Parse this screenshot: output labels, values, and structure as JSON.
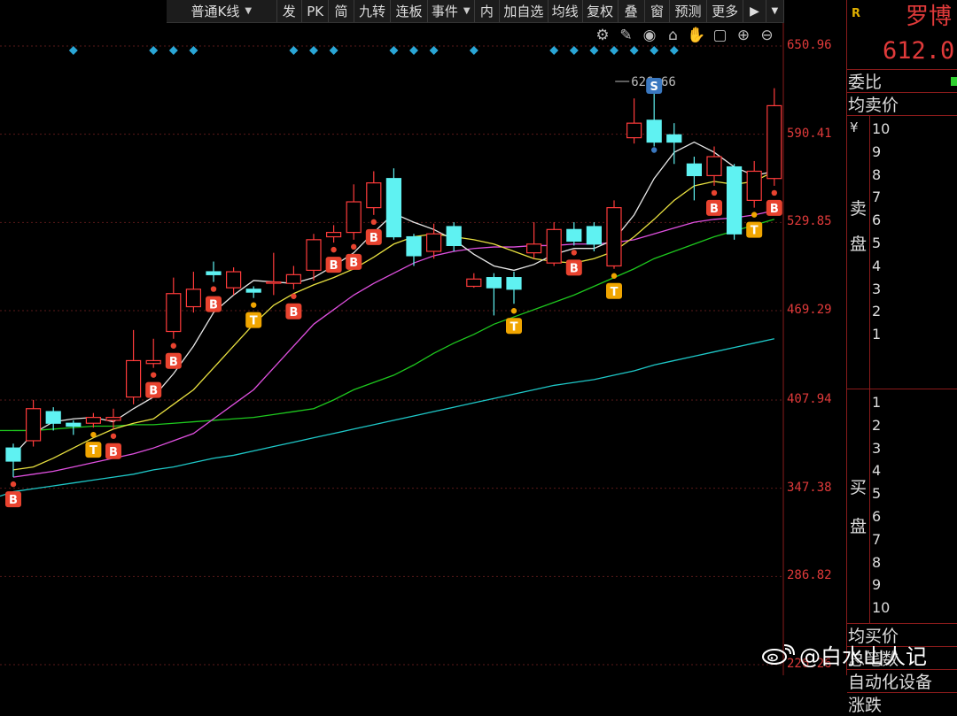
{
  "toolbar": {
    "items": [
      {
        "label": "普通K线",
        "dropdown": true
      },
      {
        "label": "发"
      },
      {
        "label": "PK"
      },
      {
        "label": "简"
      },
      {
        "label": "九转"
      },
      {
        "label": "连板"
      },
      {
        "label": "事件",
        "dropdown": true
      },
      {
        "label": "内"
      },
      {
        "label": "加自选"
      },
      {
        "label": "均线"
      },
      {
        "label": "复权"
      },
      {
        "label": "叠"
      },
      {
        "label": "窗"
      },
      {
        "label": "预测"
      },
      {
        "label": "更多"
      }
    ]
  },
  "chart_tools": [
    "settings-icon",
    "pen-icon",
    "eye-icon",
    "basket-icon",
    "hand-icon",
    "lock-icon",
    "zoom-in-icon",
    "zoom-out-icon"
  ],
  "price_axis": [
    "650.96",
    "590.41",
    "529.85",
    "469.29",
    "407.94",
    "347.38",
    "286.82",
    "226.26"
  ],
  "chart_data": {
    "type": "candlestick",
    "y_range": [
      226.26,
      650.96
    ],
    "high_annotation": "626.66",
    "colors": {
      "up": "#ff3b3b",
      "down": "#5ff2f2",
      "ma5": "#e8e8e8",
      "ma10": "#e8e040",
      "ma20": "#e050e0",
      "ma60": "#1ec81e",
      "ma120": "#1ec8c8"
    },
    "candles": [
      {
        "o": 375,
        "c": 366,
        "h": 378,
        "l": 355
      },
      {
        "o": 380,
        "c": 402,
        "h": 408,
        "l": 376
      },
      {
        "o": 400,
        "c": 392,
        "h": 403,
        "l": 387
      },
      {
        "o": 392,
        "c": 390,
        "h": 394,
        "l": 384
      },
      {
        "o": 392,
        "c": 396,
        "h": 399,
        "l": 389
      },
      {
        "o": 394,
        "c": 396,
        "h": 402,
        "l": 388
      },
      {
        "o": 410,
        "c": 435,
        "h": 456,
        "l": 405
      },
      {
        "o": 433,
        "c": 435,
        "h": 450,
        "l": 430
      },
      {
        "o": 455,
        "c": 481,
        "h": 492,
        "l": 450
      },
      {
        "o": 472,
        "c": 484,
        "h": 496,
        "l": 468
      },
      {
        "o": 496,
        "c": 494,
        "h": 503,
        "l": 489
      },
      {
        "o": 485,
        "c": 496,
        "h": 499,
        "l": 480
      },
      {
        "o": 484,
        "c": 482,
        "h": 486,
        "l": 478
      },
      {
        "o": 489,
        "c": 489,
        "h": 509,
        "l": 480
      },
      {
        "o": 488,
        "c": 494,
        "h": 500,
        "l": 484
      },
      {
        "o": 497,
        "c": 518,
        "h": 522,
        "l": 490
      },
      {
        "o": 520,
        "c": 523,
        "h": 528,
        "l": 516
      },
      {
        "o": 523,
        "c": 544,
        "h": 556,
        "l": 518
      },
      {
        "o": 540,
        "c": 557,
        "h": 565,
        "l": 535
      },
      {
        "o": 560,
        "c": 520,
        "h": 567,
        "l": 518
      },
      {
        "o": 520,
        "c": 507,
        "h": 522,
        "l": 500
      },
      {
        "o": 510,
        "c": 522,
        "h": 529,
        "l": 505
      },
      {
        "o": 527,
        "c": 514,
        "h": 530,
        "l": 510
      },
      {
        "o": 486,
        "c": 491,
        "h": 495,
        "l": 485
      },
      {
        "o": 492,
        "c": 485,
        "h": 495,
        "l": 466
      },
      {
        "o": 492,
        "c": 484,
        "h": 496,
        "l": 474
      },
      {
        "o": 509,
        "c": 515,
        "h": 530,
        "l": 505
      },
      {
        "o": 502,
        "c": 525,
        "h": 530,
        "l": 500
      },
      {
        "o": 525,
        "c": 517,
        "h": 530,
        "l": 514
      },
      {
        "o": 527,
        "c": 515,
        "h": 530,
        "l": 510
      },
      {
        "o": 500,
        "c": 540,
        "h": 545,
        "l": 498
      },
      {
        "o": 588,
        "c": 598,
        "h": 615,
        "l": 584
      },
      {
        "o": 600,
        "c": 585,
        "h": 626.66,
        "l": 582
      },
      {
        "o": 590,
        "c": 585,
        "h": 598,
        "l": 570
      },
      {
        "o": 570,
        "c": 562,
        "h": 575,
        "l": 545
      },
      {
        "o": 562,
        "c": 575,
        "h": 582,
        "l": 555
      },
      {
        "o": 568,
        "c": 522,
        "h": 570,
        "l": 518
      },
      {
        "o": 545,
        "c": 565,
        "h": 572,
        "l": 540
      },
      {
        "o": 560,
        "c": 610,
        "h": 622,
        "l": 555
      }
    ],
    "ma5": [
      370,
      385,
      393,
      395,
      396,
      393,
      402,
      410,
      426,
      445,
      468,
      480,
      490,
      489,
      488,
      492,
      500,
      509,
      523,
      536,
      530,
      525,
      518,
      508,
      500,
      497,
      501,
      508,
      512,
      512,
      518,
      535,
      560,
      578,
      585,
      578,
      568,
      562,
      565
    ],
    "ma10": [
      360,
      362,
      368,
      375,
      382,
      388,
      392,
      395,
      405,
      415,
      430,
      445,
      460,
      473,
      481,
      487,
      492,
      498,
      506,
      515,
      520,
      522,
      520,
      518,
      515,
      510,
      505,
      503,
      502,
      505,
      510,
      520,
      532,
      545,
      555,
      558,
      556,
      558,
      565
    ],
    "ma20": [
      355,
      357,
      359,
      362,
      365,
      368,
      371,
      375,
      380,
      385,
      395,
      405,
      415,
      430,
      445,
      460,
      470,
      480,
      488,
      495,
      502,
      507,
      510,
      512,
      513,
      513,
      514,
      514,
      515,
      515,
      516,
      518,
      522,
      526,
      530,
      532,
      533,
      535,
      538
    ],
    "ma60": [
      387,
      387,
      388,
      389,
      390,
      390,
      391,
      391,
      392,
      393,
      394,
      395,
      396,
      398,
      400,
      402,
      408,
      415,
      420,
      425,
      432,
      440,
      447,
      453,
      460,
      465,
      470,
      475,
      480,
      486,
      492,
      498,
      505,
      510,
      515,
      520,
      524,
      528,
      532
    ],
    "ma120": [
      345,
      347,
      349,
      351,
      353,
      355,
      357,
      360,
      362,
      365,
      368,
      370,
      373,
      376,
      379,
      382,
      385,
      388,
      391,
      394,
      397,
      400,
      403,
      406,
      409,
      412,
      415,
      418,
      420,
      422,
      425,
      428,
      432,
      435,
      438,
      441,
      444,
      447,
      450
    ],
    "signals": [
      {
        "type": "B",
        "i": 0
      },
      {
        "type": "T",
        "i": 4
      },
      {
        "type": "B",
        "i": 5
      },
      {
        "type": "B",
        "i": 7
      },
      {
        "type": "B",
        "i": 8
      },
      {
        "type": "B",
        "i": 10
      },
      {
        "type": "T",
        "i": 12
      },
      {
        "type": "B",
        "i": 14
      },
      {
        "type": "B",
        "i": 16
      },
      {
        "type": "B",
        "i": 17
      },
      {
        "type": "B",
        "i": 18
      },
      {
        "type": "T",
        "i": 25
      },
      {
        "type": "B",
        "i": 28
      },
      {
        "type": "T",
        "i": 30
      },
      {
        "type": "S",
        "i": 32
      },
      {
        "type": "B",
        "i": 35
      },
      {
        "type": "T",
        "i": 37
      },
      {
        "type": "B",
        "i": 38
      }
    ],
    "diamond_marks": [
      3,
      7,
      8,
      9,
      14,
      15,
      16,
      19,
      20,
      21,
      23,
      27,
      28,
      29,
      30,
      31,
      32,
      33
    ]
  },
  "right_panel": {
    "tag": "R",
    "stock_name": "罗博",
    "price": "612.0",
    "commit_ratio_label": "委比",
    "commit_ratio_value": "-",
    "avg_sell_label": "均卖价",
    "currency_symbol": "¥",
    "sell_side_label": [
      "卖",
      "盘"
    ],
    "sell_levels": [
      "10",
      "9",
      "8",
      "7",
      "6",
      "5",
      "4",
      "3",
      "2",
      "1"
    ],
    "buy_side_label": [
      "买",
      "盘"
    ],
    "buy_levels": [
      "1",
      "2",
      "3",
      "4",
      "5",
      "6",
      "7",
      "8",
      "9",
      "10"
    ],
    "avg_buy_label": "均买价",
    "total_trades_label": "总笔数",
    "sector_label": "自动化设备",
    "last_row_label": "涨跌"
  },
  "watermark": {
    "text": "@白水山人记"
  }
}
